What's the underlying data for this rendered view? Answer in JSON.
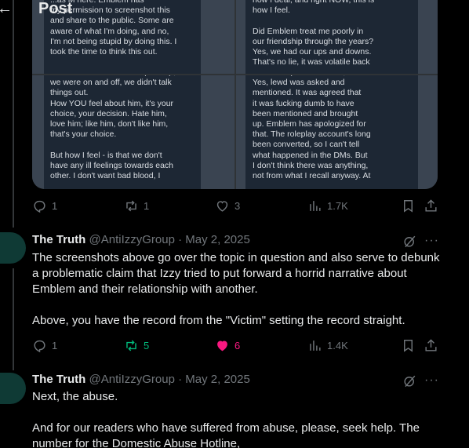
{
  "header": {
    "title": "Post",
    "back_icon": "←"
  },
  "media": {
    "tile1_text": "...as M here. Emblem has\nmy permission to screenshot this\nand share to the public. Some are\naware of what I'm doing, and no,\nI'm not being stupid by doing this. I\ntook the time to think this out.",
    "tile2_text": "how I deal, and right NOW, this is\nhow I feel.\n\nDid Emblem treat me poorly in\nour friendship through the years?\nYes, we had our ups and downs.\nThat's no lie, it was volatile back",
    "tile3_text": "because of stressors that piled up,\nwe were on and off, we didn't talk\nthings out.\nHow YOU feel about him, it's your\nchoice, your decision. Hate him,\nlove him; like him, don't like him,\nthat's your choice.\n\nBut how I feel - is that we don't\nhave any ill feelings towards each\nother. I don't want bad blood, I",
    "tile4_text": "To note important factors,\nYes, lewd was asked and\nmentioned. It was agreed that\nit was fucking dumb to have\nbeen mentioned and brought\nup. Emblem has apologized for\nthat. The roleplay account's long\nbeen converted, so I can't tell\nwhat happened in the DMs. But\nI don't think there was anything,\nnot from what I recall anyway. At"
  },
  "post0_actions": {
    "replies": "1",
    "reposts": "1",
    "likes": "3",
    "views": "1.7K"
  },
  "tweets": [
    {
      "name": "The Truth",
      "handle": "@AntiIzzyGroup · May 2, 2025",
      "body_p1": "The screenshots above go over the topic in question and also serve to debunk a problematic claim that Izzy tried to put forward a horrid narrative about Emblem and their relationship with another.",
      "body_p2": "Above, you have the record from the \"Victim\" setting the record straight.",
      "replies": "1",
      "reposts": "5",
      "likes": "6",
      "views": "1.4K"
    },
    {
      "name": "The Truth",
      "handle": "@AntiIzzyGroup · May 2, 2025",
      "body_p1": "Next, the abuse.",
      "body_p2": "And for our readers who have suffered from abuse, please, seek help. The number for the Domestic Abuse Hotline,"
    }
  ],
  "more_label": "···",
  "colors": {
    "background": "#000000",
    "text": "#e7e9ea",
    "muted": "#71767b",
    "repost_active": "#00ba7c",
    "like_active": "#f91880"
  }
}
